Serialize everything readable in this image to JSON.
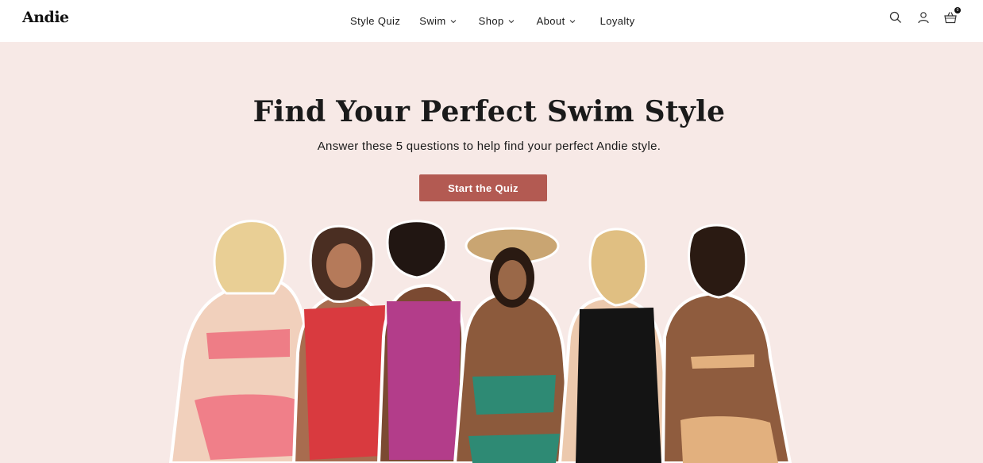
{
  "brand": {
    "logo_text": "Andie"
  },
  "nav": {
    "items": [
      {
        "label": "Style Quiz",
        "has_dropdown": false
      },
      {
        "label": "Swim",
        "has_dropdown": true
      },
      {
        "label": "Shop",
        "has_dropdown": true
      },
      {
        "label": "About",
        "has_dropdown": true
      },
      {
        "label": "Loyalty",
        "has_dropdown": false
      }
    ]
  },
  "header_icons": {
    "search": "search-icon",
    "account": "account-icon",
    "cart": "cart-icon",
    "cart_count": "0"
  },
  "hero": {
    "title": "Find Your Perfect Swim Style",
    "subtitle": "Answer these 5 questions to help find your perfect Andie style.",
    "cta_label": "Start the Quiz",
    "background_color": "#f7e9e6",
    "cta_color": "#b35a52"
  },
  "models_image": {
    "description_icon": "swimsuit-models-image",
    "swimsuit_colors": [
      "#ee7d86",
      "#d93a3f",
      "#b33d8a",
      "#2e8a74",
      "#141414",
      "#e2b07e"
    ]
  }
}
